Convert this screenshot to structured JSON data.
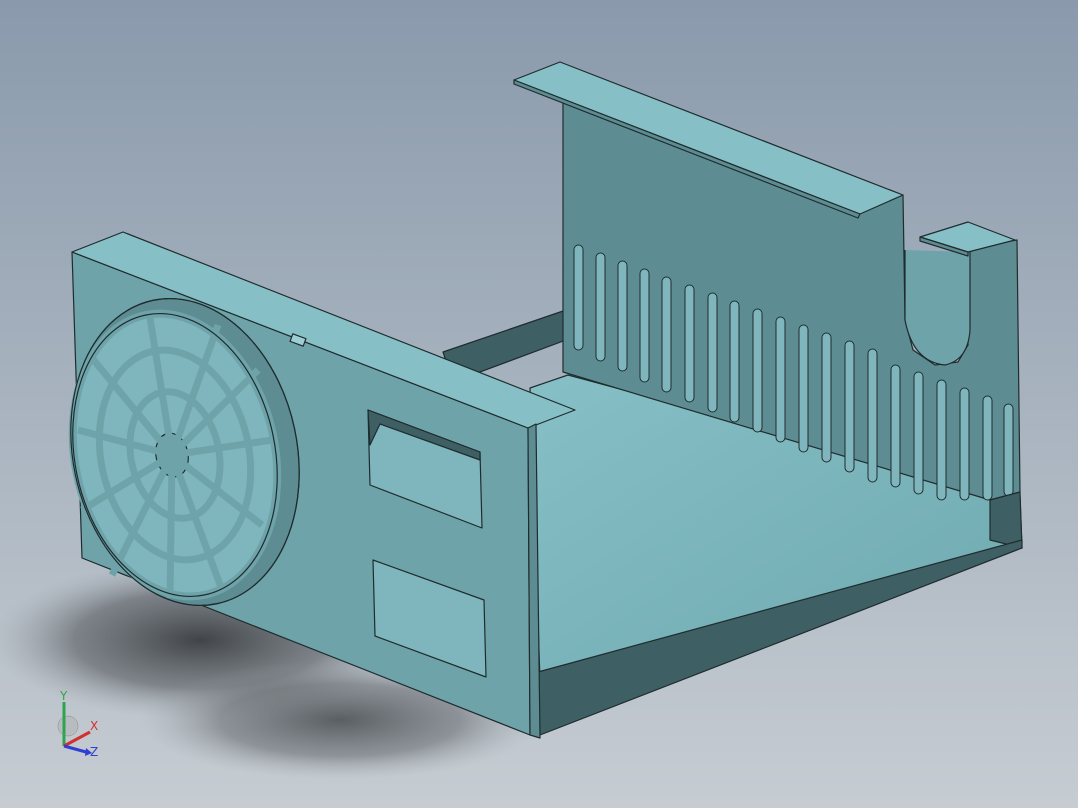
{
  "viewport": {
    "background_top": "#8a9aac",
    "background_bottom": "#c2c8cf"
  },
  "model": {
    "face_light": "#7fb6bd",
    "face_mid": "#6ea3aa",
    "face_dark": "#5d8d92",
    "face_shadow": "#3e5f63",
    "edge": "#1f2c2e"
  },
  "triad": {
    "y_label": "Y",
    "x_label": "X",
    "z_label": "Z",
    "y_color": "#2ea44f",
    "x_color": "#d03030",
    "z_color": "#2f3fd0"
  }
}
